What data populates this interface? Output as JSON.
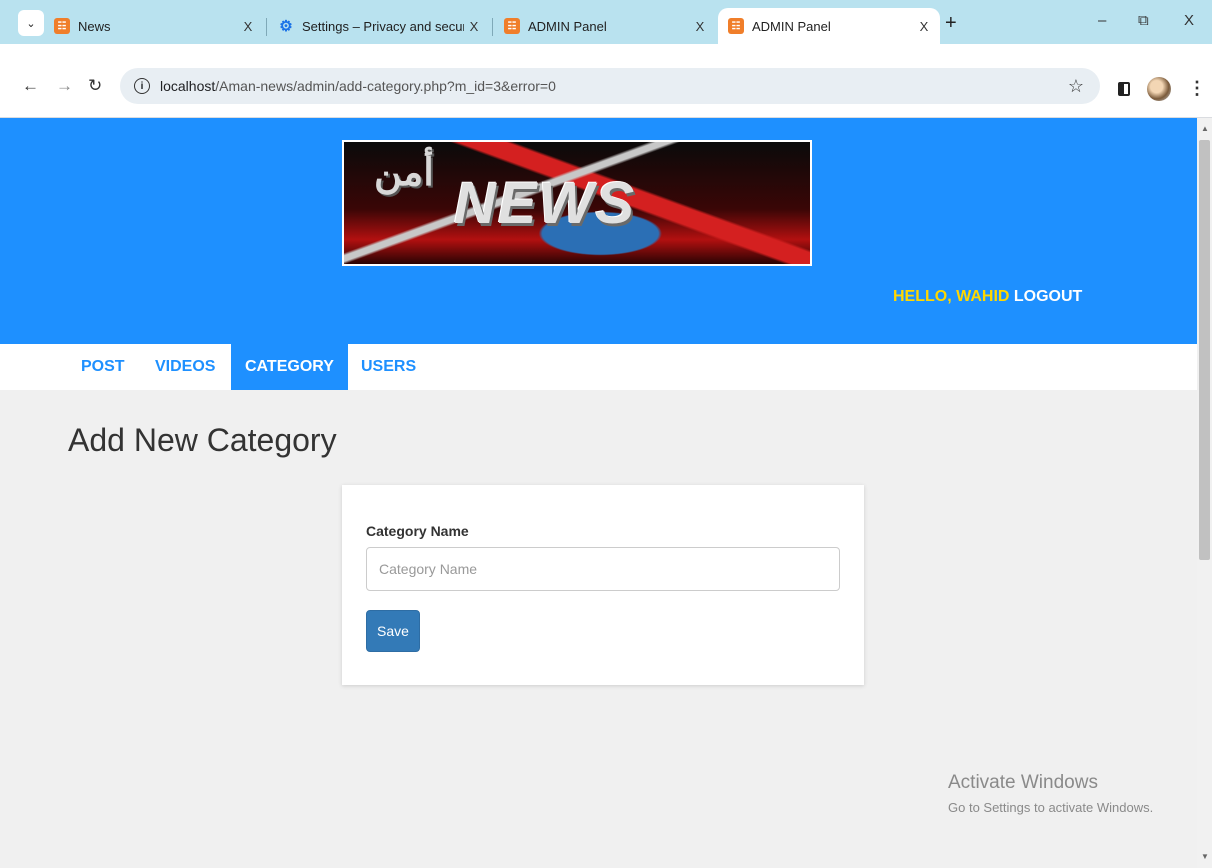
{
  "browser": {
    "tabs": [
      {
        "title": "News",
        "favicon": "xampp-icon",
        "active": false
      },
      {
        "title": "Settings – Privacy and security",
        "favicon": "gear-icon",
        "active": false
      },
      {
        "title": "ADMIN Panel",
        "favicon": "xampp-icon",
        "active": false
      },
      {
        "title": "ADMIN Panel",
        "favicon": "xampp-icon",
        "active": true
      }
    ],
    "close_glyph": "X",
    "new_tab_glyph": "+",
    "url_host": "localhost",
    "url_path": "/Aman-news/admin/add-category.php?m_id=3&error=0",
    "window_controls": {
      "minimize": "–",
      "restore": "⧉",
      "close": "X"
    }
  },
  "header": {
    "logo_text": "NEWS",
    "logo_arabic": "أمن",
    "greeting": "HELLO, WAHID",
    "logout": "LOGOUT",
    "colors": {
      "header_bg": "#1e90ff",
      "greeting": "#ffd700"
    }
  },
  "menu": {
    "items": [
      {
        "label": "POST",
        "active": false
      },
      {
        "label": "VIDEOS",
        "active": false
      },
      {
        "label": "CATEGORY",
        "active": true
      },
      {
        "label": "USERS",
        "active": false
      }
    ]
  },
  "page": {
    "heading": "Add New Category",
    "form": {
      "field_label": "Category Name",
      "field_placeholder": "Category Name",
      "field_value": "",
      "save_label": "Save"
    }
  },
  "watermark": {
    "title": "Activate Windows",
    "subtitle": "Go to Settings to activate Windows."
  }
}
